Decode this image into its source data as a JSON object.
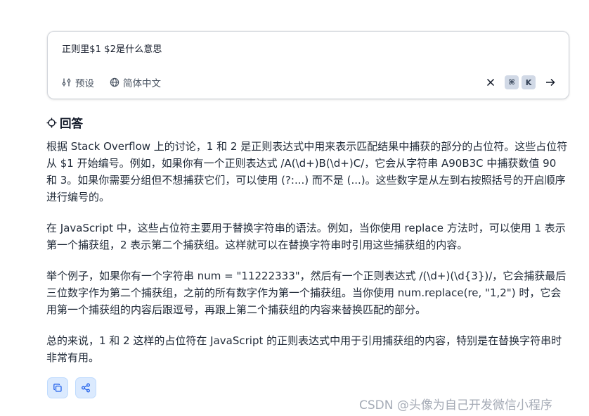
{
  "search": {
    "query": "正则里$1 $2是什么意思",
    "preset_label": "预设",
    "language_label": "简体中文",
    "shortcut_keys": [
      "⌘",
      "K"
    ]
  },
  "answer": {
    "heading": "回答",
    "paragraphs": [
      "根据 Stack Overflow 上的讨论，1 和 2 是正则表达式中用来表示匹配结果中捕获的部分的占位符。这些占位符从 $1 开始编号。例如，如果你有一个正则表达式 /A(\\d+)B(\\d+)C/，它会从字符串 A90B3C 中捕获数值 90 和 3。如果你需要分组但不想捕获它们，可以使用 (?:...) 而不是 (...)。这些数字是从左到右按照括号的开启顺序进行编号的。",
      "在 JavaScript 中，这些占位符主要用于替换字符串的语法。例如，当你使用 replace 方法时，可以使用 1 表示第一个捕获组，2 表示第二个捕获组。这样就可以在替换字符串时引用这些捕获组的内容。",
      "举个例子，如果你有一个字符串 num = \"11222333\"，然后有一个正则表达式 /(\\d+)(\\d{3})/，它会捕获最后三位数字作为第二个捕获组，之前的所有数字作为第一个捕获组。当你使用 num.replace(re, \"1,2\") 时，它会用第一个捕获组的内容后跟逗号，再跟上第二个捕获组的内容来替换匹配的部分。",
      "总的来说，1 和 2 这样的占位符在 JavaScript 的正则表达式中用于引用捕获组的内容，特别是在替换字符串时非常有用。"
    ]
  },
  "icons": {
    "preset": "sliders-icon",
    "language": "globe-icon",
    "clear": "close-icon",
    "submit": "arrow-right-icon",
    "answer": "crosshair-icon",
    "copy": "copy-icon",
    "share": "share-icon"
  },
  "watermark": "CSDN @头像为自己开发微信小程序",
  "colors": {
    "action_bg": "#dbeafe",
    "kbd_bg": "#d1d9e6",
    "watermark": "#9ca3af"
  }
}
